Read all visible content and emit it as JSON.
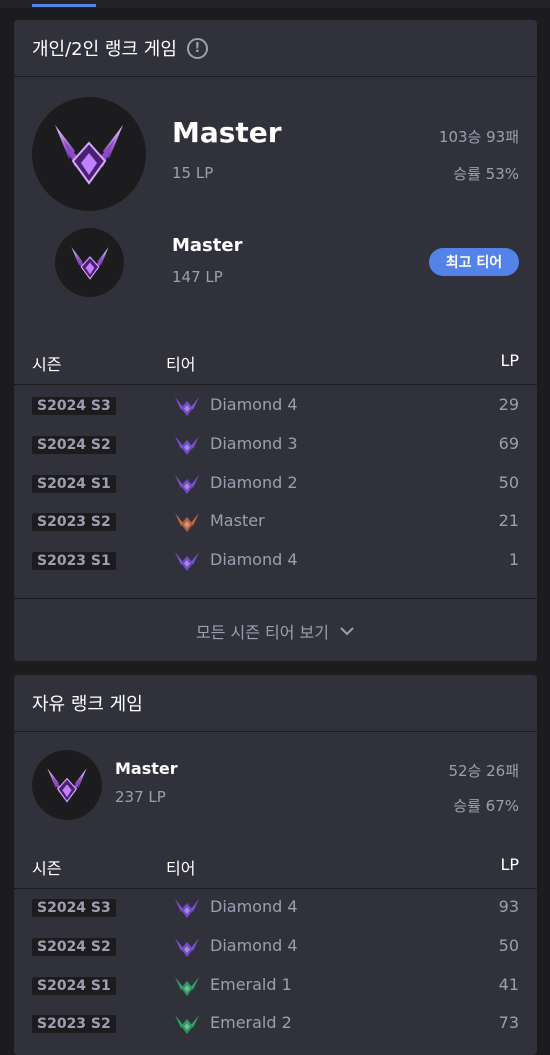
{
  "solo": {
    "title": "개인/2인 랭크 게임",
    "current": {
      "tier": "Master",
      "lp": "15 LP",
      "record": "103승 93패",
      "winrate": "승률 53%"
    },
    "peak": {
      "tier": "Master",
      "lp": "147 LP",
      "badge": "최고 티어"
    },
    "columns": {
      "season": "시즌",
      "tier": "티어",
      "lp": "LP"
    },
    "seasons": [
      {
        "season": "S2024 S3",
        "tier": "Diamond 4",
        "lp": "29",
        "icon": "diamond"
      },
      {
        "season": "S2024 S2",
        "tier": "Diamond 3",
        "lp": "69",
        "icon": "diamond"
      },
      {
        "season": "S2024 S1",
        "tier": "Diamond 2",
        "lp": "50",
        "icon": "diamond"
      },
      {
        "season": "S2023 S2",
        "tier": "Master",
        "lp": "21",
        "icon": "master"
      },
      {
        "season": "S2023 S1",
        "tier": "Diamond 4",
        "lp": "1",
        "icon": "diamond"
      }
    ],
    "show_all": "모든 시즌 티어 보기"
  },
  "flex": {
    "title": "자유 랭크 게임",
    "current": {
      "tier": "Master",
      "lp": "237 LP",
      "record": "52승 26패",
      "winrate": "승률 67%"
    },
    "columns": {
      "season": "시즌",
      "tier": "티어",
      "lp": "LP"
    },
    "seasons": [
      {
        "season": "S2024 S3",
        "tier": "Diamond 4",
        "lp": "93",
        "icon": "diamond"
      },
      {
        "season": "S2024 S2",
        "tier": "Diamond 4",
        "lp": "50",
        "icon": "diamond"
      },
      {
        "season": "S2024 S1",
        "tier": "Emerald 1",
        "lp": "41",
        "icon": "emerald"
      },
      {
        "season": "S2023 S2",
        "tier": "Emerald 2",
        "lp": "73",
        "icon": "emerald"
      }
    ]
  },
  "colors": {
    "accent": "#5383e8",
    "diamond": "#7b4fd6",
    "master": "#c0673f",
    "emerald": "#2fa360"
  },
  "icons": {
    "info": "info-icon",
    "chevron": "chevron-down-icon",
    "emblem": "master-emblem-icon"
  }
}
